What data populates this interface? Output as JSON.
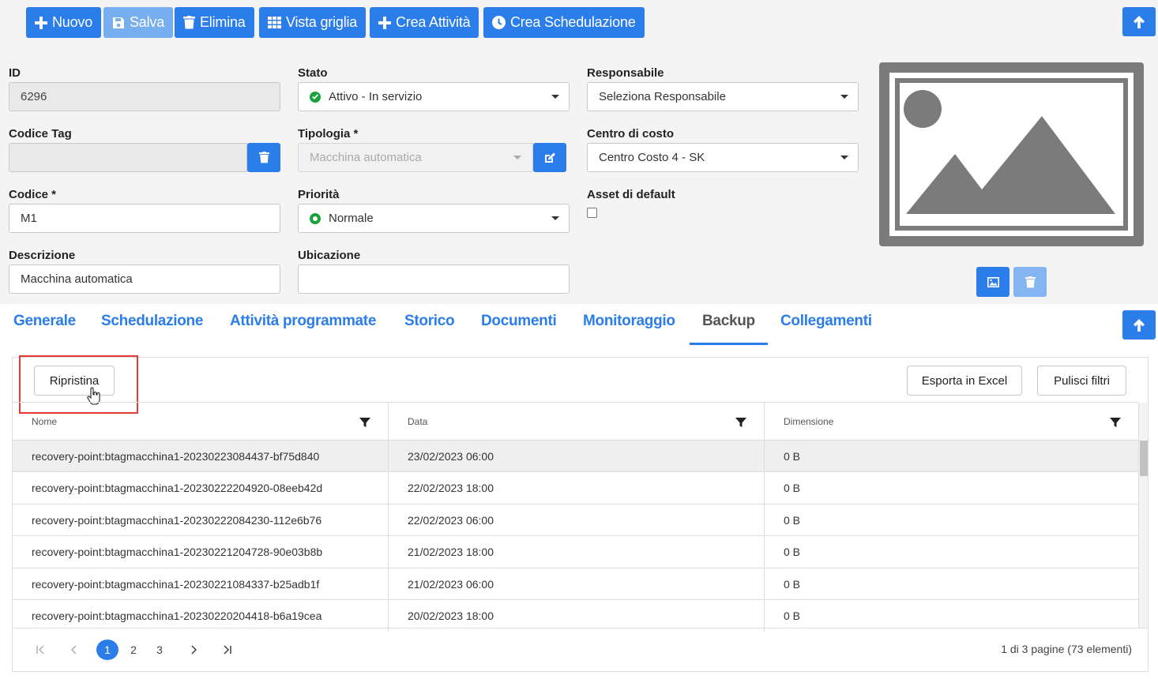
{
  "toolbar": {
    "nuovo": "Nuovo",
    "salva": "Salva",
    "elimina": "Elimina",
    "vista_griglia": "Vista griglia",
    "crea_attivita": "Crea Attività",
    "crea_schedulazione": "Crea Schedulazione"
  },
  "form": {
    "id_label": "ID",
    "id_value": "6296",
    "codice_tag_label": "Codice Tag",
    "codice_tag_value": "",
    "codice_label": "Codice *",
    "codice_value": "M1",
    "descrizione_label": "Descrizione",
    "descrizione_value": "Macchina automatica",
    "stato_label": "Stato",
    "stato_value": "Attivo - In servizio",
    "tipologia_label": "Tipologia *",
    "tipologia_value": "Macchina automatica",
    "priorita_label": "Priorità",
    "priorita_value": "Normale",
    "ubicazione_label": "Ubicazione",
    "ubicazione_value": "",
    "responsabile_label": "Responsabile",
    "responsabile_value": "Seleziona Responsabile",
    "centro_costo_label": "Centro di costo",
    "centro_costo_value": "Centro Costo 4 - SK",
    "asset_default_label": "Asset di default",
    "asset_default_checked": false
  },
  "tabs": [
    {
      "label": "Generale"
    },
    {
      "label": "Schedulazione"
    },
    {
      "label": "Attività programmate"
    },
    {
      "label": "Storico"
    },
    {
      "label": "Documenti"
    },
    {
      "label": "Monitoraggio"
    },
    {
      "label": "Backup"
    },
    {
      "label": "Collegamenti"
    }
  ],
  "active_tab": "Backup",
  "grid": {
    "ripristina": "Ripristina",
    "esporta_excel": "Esporta in Excel",
    "pulisci_filtri": "Pulisci filtri",
    "columns": [
      "Nome",
      "Data",
      "Dimensione"
    ],
    "rows": [
      {
        "nome": "recovery-point:btagmacchina1-20230223084437-bf75d840",
        "data": "23/02/2023 06:00",
        "dim": "0 B"
      },
      {
        "nome": "recovery-point:btagmacchina1-20230222204920-08eeb42d",
        "data": "22/02/2023 18:00",
        "dim": "0 B"
      },
      {
        "nome": "recovery-point:btagmacchina1-20230222084230-112e6b76",
        "data": "22/02/2023 06:00",
        "dim": "0 B"
      },
      {
        "nome": "recovery-point:btagmacchina1-20230221204728-90e03b8b",
        "data": "21/02/2023 18:00",
        "dim": "0 B"
      },
      {
        "nome": "recovery-point:btagmacchina1-20230221084337-b25adb1f",
        "data": "21/02/2023 06:00",
        "dim": "0 B"
      },
      {
        "nome": "recovery-point:btagmacchina1-20230220204418-b6a19cea",
        "data": "20/02/2023 18:00",
        "dim": "0 B"
      }
    ],
    "pager": {
      "pages": [
        "1",
        "2",
        "3"
      ],
      "current": "1",
      "summary": "1 di 3 pagine (73 elementi)"
    }
  },
  "colors": {
    "accent": "#2b7de9",
    "status_green": "#1aa33d",
    "highlight": "#e53935"
  }
}
